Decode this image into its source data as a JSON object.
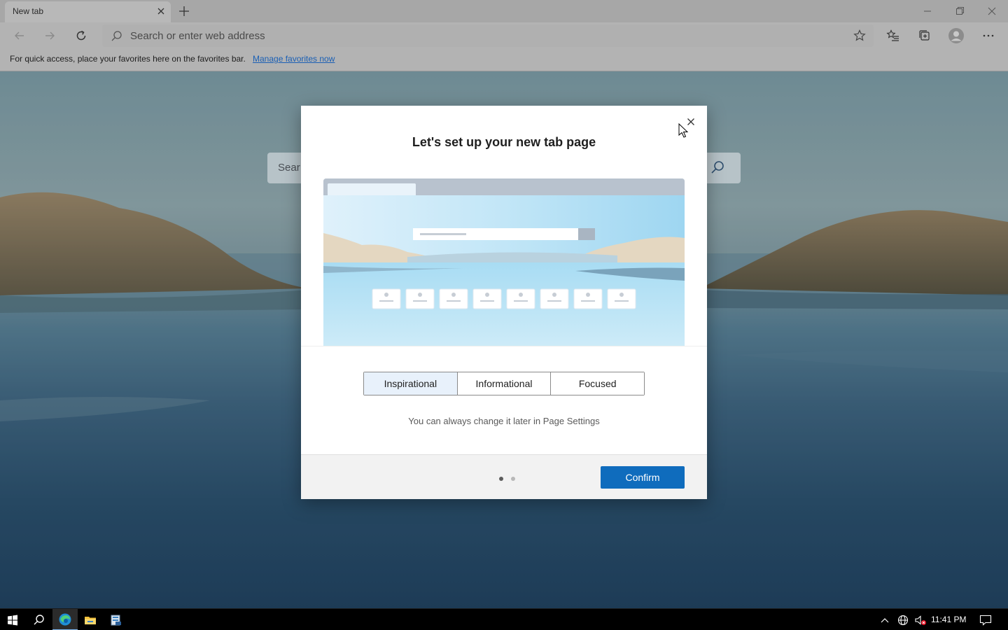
{
  "browser": {
    "tab_title": "New tab",
    "address_placeholder": "Search or enter web address",
    "favorites_bar": {
      "message": "For quick access, place your favorites here on the favorites bar.",
      "link": "Manage favorites now"
    }
  },
  "page": {
    "search_placeholder": "Sear"
  },
  "modal": {
    "title": "Let's set up your new tab page",
    "options": [
      "Inspirational",
      "Informational",
      "Focused"
    ],
    "selected_option": "Inspirational",
    "hint": "You can always change it later in Page Settings",
    "confirm_label": "Confirm",
    "pagination": {
      "current": 1,
      "total": 2
    }
  },
  "taskbar": {
    "clock": "11:41 PM"
  },
  "colors": {
    "accent": "#0f6cbd",
    "link": "#1a5fb4"
  },
  "icons": {
    "toolbar": [
      "back-arrow-icon",
      "forward-arrow-icon",
      "refresh-icon",
      "search-icon",
      "star-add-icon",
      "favorites-icon",
      "collections-icon",
      "profile-avatar-icon",
      "more-icon"
    ],
    "taskbar": [
      "windows-start-icon",
      "search-icon",
      "edge-icon",
      "file-explorer-icon",
      "server-manager-icon"
    ],
    "tray": [
      "chevron-up-icon",
      "network-icon",
      "volume-muted-icon",
      "notification-icon"
    ]
  }
}
